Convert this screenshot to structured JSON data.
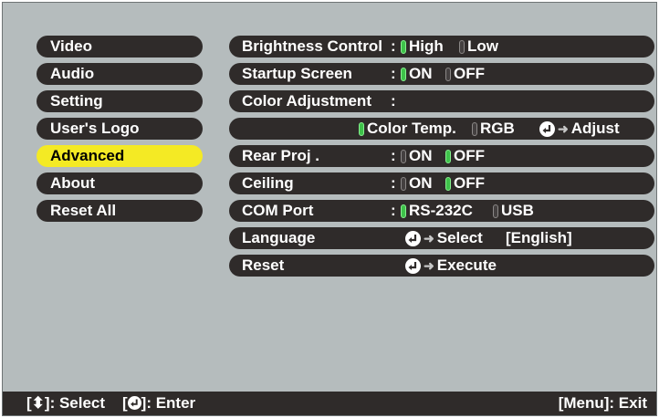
{
  "menu": {
    "items": [
      {
        "label": "Video"
      },
      {
        "label": "Audio"
      },
      {
        "label": "Setting"
      },
      {
        "label": "User's Logo"
      },
      {
        "label": "Advanced",
        "active": true
      },
      {
        "label": "About"
      },
      {
        "label": "Reset All"
      }
    ]
  },
  "settings": {
    "brightness": {
      "label": "Brightness Control",
      "colon": ":",
      "options": [
        "High",
        "Low"
      ],
      "selected": "High"
    },
    "startup": {
      "label": "Startup Screen",
      "colon": ":",
      "options": [
        "ON",
        "OFF"
      ],
      "selected": "ON"
    },
    "color_adjustment": {
      "label": "Color Adjustment",
      "colon": ":"
    },
    "color_mode": {
      "options": [
        "Color Temp.",
        "RGB"
      ],
      "selected": "Color Temp.",
      "action": "Adjust"
    },
    "rear_proj": {
      "label": "Rear Proj .",
      "colon": ":",
      "options": [
        "ON",
        "OFF"
      ],
      "selected": "OFF"
    },
    "ceiling": {
      "label": "Ceiling",
      "colon": ":",
      "options": [
        "ON",
        "OFF"
      ],
      "selected": "OFF"
    },
    "com_port": {
      "label": "COM Port",
      "colon": ":",
      "options": [
        "RS-232C",
        "USB"
      ],
      "selected": "RS-232C"
    },
    "language": {
      "label": "Language",
      "action": "Select",
      "value": "[English]"
    },
    "reset": {
      "label": "Reset",
      "action": "Execute"
    }
  },
  "footer": {
    "select_key": "[⬍]",
    "select_label": ": Select",
    "enter_open": "[",
    "enter_close": "]",
    "enter_label": ": Enter",
    "exit": "[Menu]: Exit"
  },
  "colors": {
    "screen_bg": "#b5bcbd",
    "pill_bg": "#2f2b2a",
    "active_bg": "#f4ea24",
    "dot_on": "#3ec24a"
  },
  "icons": {
    "enter": "enter-key-icon",
    "arrow": "right-arrow-icon",
    "dot": "radio-dot-icon"
  }
}
